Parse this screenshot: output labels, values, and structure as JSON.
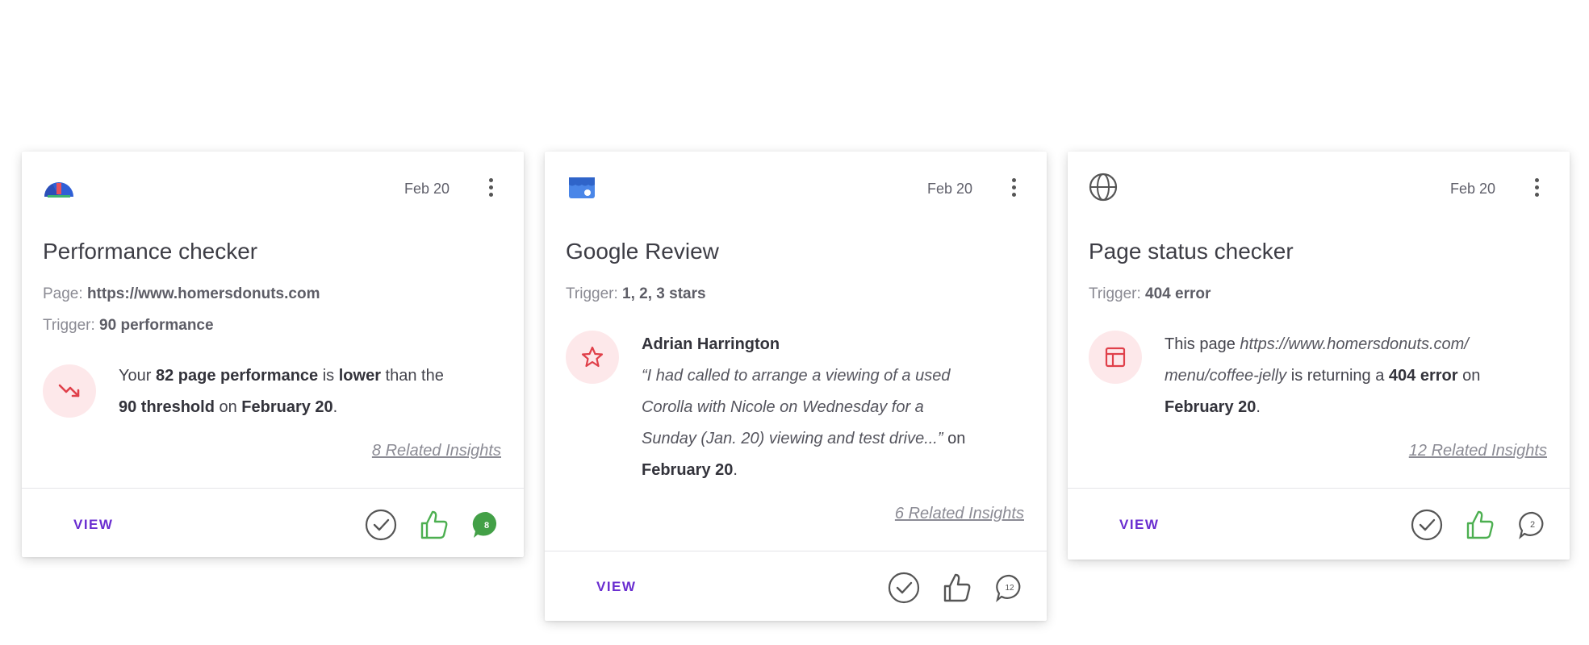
{
  "colors": {
    "accent": "#6a2ed0",
    "alert_bg": "#fde8ea",
    "alert_icon": "#e0404a",
    "thumb_green": "#4caf50",
    "chat_green": "#43a047"
  },
  "cards": [
    {
      "source_icon": "performance-gauge-icon",
      "date": "Feb 20",
      "title": "Performance checker",
      "page_label": "Page:",
      "page_value": "https://www.homersdonuts.com",
      "trigger_label": "Trigger:",
      "trigger_value": "90 performance",
      "alert_icon": "trending-down-icon",
      "alert": {
        "t1": "Your ",
        "b1": "82 page performance",
        "t2": " is ",
        "b2": "lower",
        "t3": " than the",
        "b3": "90 threshold",
        "t4": " on ",
        "b4": "February 20",
        "t5": "."
      },
      "related": "8 Related Insights",
      "view_label": "VIEW",
      "comment_count": "8"
    },
    {
      "source_icon": "google-my-business-icon",
      "date": "Feb 20",
      "title": "Google Review",
      "trigger_label": "Trigger:",
      "trigger_value": "1, 2, 3 stars",
      "alert_icon": "star-icon",
      "review": {
        "author": "Adrian Harrington",
        "q1": "“I had called to arrange a viewing of a used",
        "q2": "Corolla with Nicole on Wednesday for a",
        "q3": "Sunday (Jan. 20) viewing and test drive...”",
        "t_on": " on",
        "date_bold": "February 20",
        "t_end": "."
      },
      "related": "6 Related Insights",
      "view_label": "VIEW",
      "comment_count": "12"
    },
    {
      "source_icon": "globe-icon",
      "date": "Feb 20",
      "title": "Page status checker",
      "trigger_label": "Trigger:",
      "trigger_value": "404 error",
      "alert_icon": "page-layout-icon",
      "alert": {
        "t1": "This page ",
        "i1": "https://www.homersdonuts.com/",
        "i2": "menu/coffee-jelly",
        "t2": " is returning a ",
        "b1": "404 error",
        "t3": " on",
        "b2": "February 20",
        "t4": "."
      },
      "related": "12 Related Insights",
      "view_label": "VIEW",
      "comment_count": "2"
    }
  ]
}
